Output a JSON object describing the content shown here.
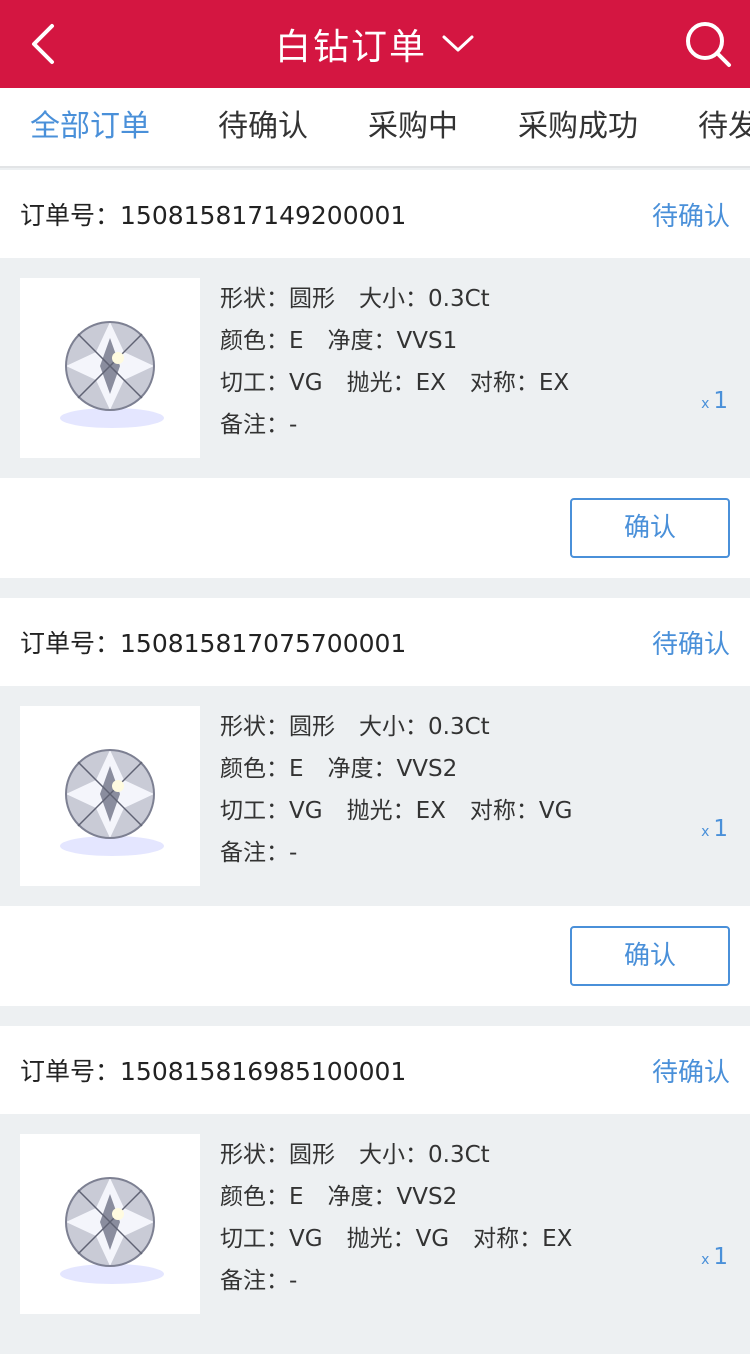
{
  "navbar": {
    "title": "白钻订单",
    "back_icon": "back-chevron-icon",
    "dropdown_icon": "chevron-down-icon",
    "search_icon": "search-icon",
    "bg_color": "#d41641"
  },
  "tabs": [
    {
      "label": "全部订单",
      "active": true
    },
    {
      "label": "待确认",
      "active": false
    },
    {
      "label": "采购中",
      "active": false
    },
    {
      "label": "采购成功",
      "active": false
    },
    {
      "label": "待发",
      "active": false
    }
  ],
  "accent_color": "#4a90d9",
  "orders": [
    {
      "order_label": "订单号：",
      "order_no": "150815817149200001",
      "status": "待确认",
      "specs": {
        "row1": [
          "形状：圆形",
          "大小：0.3Ct"
        ],
        "row2": [
          "颜色：E",
          "净度：VVS1"
        ],
        "row3": [
          "切工：VG",
          "抛光：EX",
          "对称：EX"
        ],
        "row4": [
          "备注：-"
        ]
      },
      "qty_x": "x",
      "qty": "1",
      "button": "确认"
    },
    {
      "order_label": "订单号：",
      "order_no": "150815817075700001",
      "status": "待确认",
      "specs": {
        "row1": [
          "形状：圆形",
          "大小：0.3Ct"
        ],
        "row2": [
          "颜色：E",
          "净度：VVS2"
        ],
        "row3": [
          "切工：VG",
          "抛光：EX",
          "对称：VG"
        ],
        "row4": [
          "备注：-"
        ]
      },
      "qty_x": "x",
      "qty": "1",
      "button": "确认"
    },
    {
      "order_label": "订单号：",
      "order_no": "150815816985100001",
      "status": "待确认",
      "specs": {
        "row1": [
          "形状：圆形",
          "大小：0.3Ct"
        ],
        "row2": [
          "颜色：E",
          "净度：VVS2"
        ],
        "row3": [
          "切工：VG",
          "抛光：VG",
          "对称：EX"
        ],
        "row4": [
          "备注：-"
        ]
      },
      "qty_x": "x",
      "qty": "1",
      "button": ""
    }
  ]
}
